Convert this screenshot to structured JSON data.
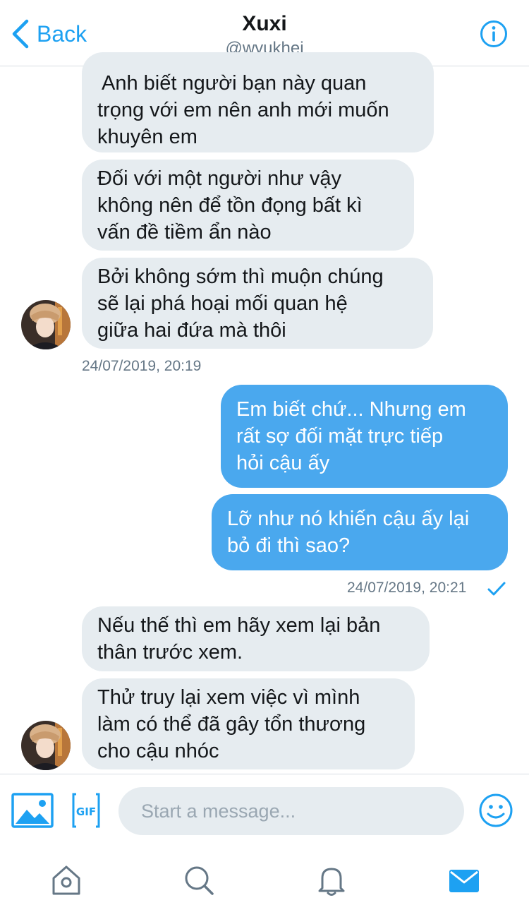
{
  "header": {
    "back_label": "Back",
    "title": "Xuxi",
    "handle": "@wyukhei"
  },
  "messages": [
    {
      "direction": "in",
      "lines": [
        "Anh biết người bạn này quan",
        "trọng với em nên anh mới muốn",
        "khuyên em"
      ]
    },
    {
      "direction": "in",
      "lines": [
        "Đối với một người như vậy",
        "không nên để tồn đọng bất kì",
        "vấn đề tiềm ẩn nào"
      ]
    },
    {
      "direction": "in",
      "lines": [
        "Bởi không sớm thì muộn chúng",
        "sẽ lại phá hoại mối quan hệ",
        "giữa hai đứa mà thôi"
      ]
    },
    {
      "direction": "out",
      "lines": [
        "Em biết chứ... Nhưng em",
        "rất sợ đối mặt trực tiếp",
        "hỏi cậu ấy"
      ]
    },
    {
      "direction": "out",
      "lines": [
        "Lỡ như nó khiến cậu ấy lại",
        "bỏ đi thì sao?"
      ]
    },
    {
      "direction": "in",
      "lines": [
        "Nếu thế thì em hãy xem lại bản",
        "thân trước xem."
      ]
    },
    {
      "direction": "in",
      "lines": [
        "Thử truy lại xem việc vì mình",
        "làm có thể đã gây tổn thương",
        "cho cậu nhóc"
      ]
    }
  ],
  "timestamps": {
    "first": "24/07/2019, 20:19",
    "second": "24/07/2019, 20:21"
  },
  "composer": {
    "placeholder": "Start a message...",
    "gif_label": "GIF"
  },
  "tabs": [
    "home-icon",
    "search-icon",
    "notifications-icon",
    "messages-icon"
  ],
  "colors": {
    "accent": "#1da1f2",
    "outgoing_bubble": "#4aa8ee",
    "incoming_bubble": "#e6ecf0",
    "secondary_text": "#657786"
  }
}
